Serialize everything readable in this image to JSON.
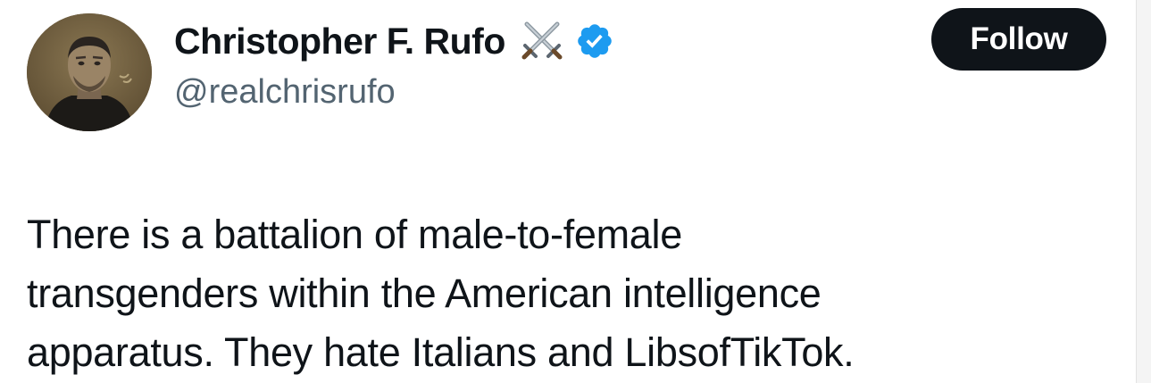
{
  "author": {
    "display_name": "Christopher F. Rufo",
    "handle": "@realchrisrufo",
    "name_emoji": "crossed-swords-icon",
    "verified": true,
    "verified_color": "#1d9bf0"
  },
  "actions": {
    "follow_label": "Follow",
    "follow_bg": "#0f1419"
  },
  "tweet": {
    "lines": [
      "There is a battalion of male-to-female",
      "transgenders within the American intelligence",
      "apparatus. They hate Italians and LibsofTikTok."
    ]
  }
}
